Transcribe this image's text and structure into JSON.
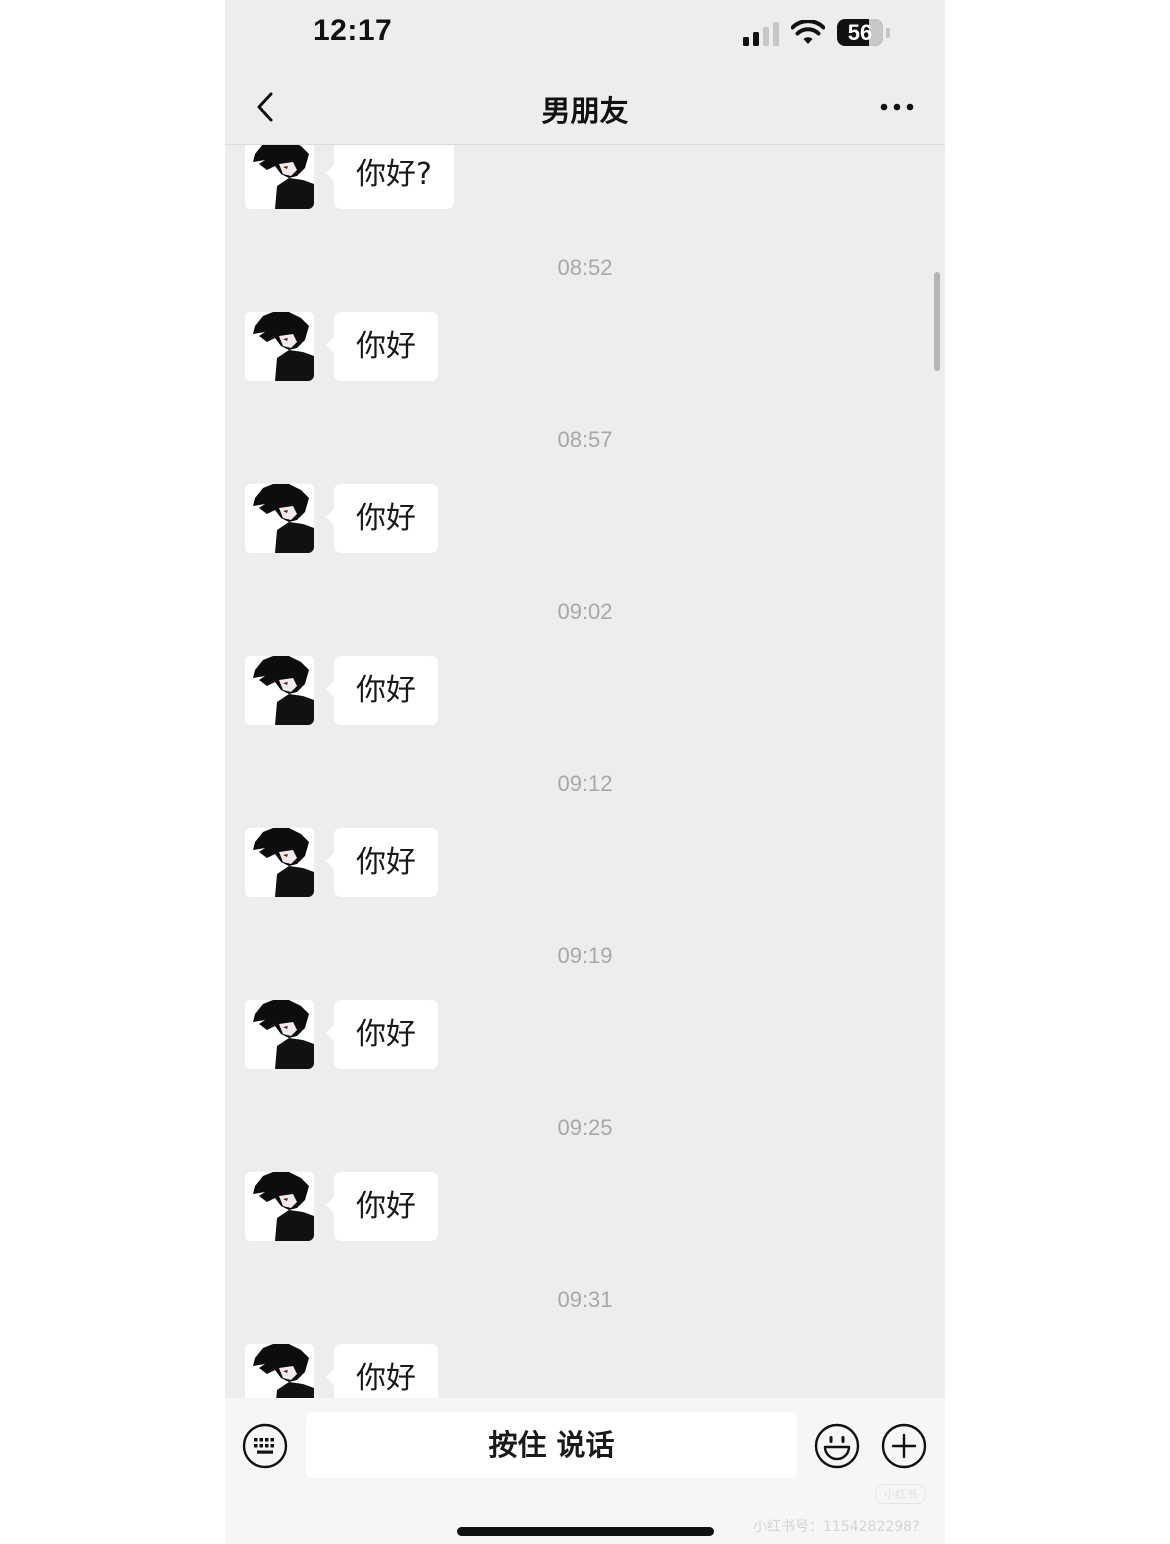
{
  "status_bar": {
    "time": "12:17",
    "battery": "56"
  },
  "nav": {
    "title": "男朋友"
  },
  "messages": [
    {
      "text": "你好?"
    },
    {
      "time": "08:52",
      "text": "你好"
    },
    {
      "time": "08:57",
      "text": "你好"
    },
    {
      "time": "09:02",
      "text": "你好"
    },
    {
      "time": "09:12",
      "text": "你好"
    },
    {
      "time": "09:19",
      "text": "你好"
    },
    {
      "time": "09:25",
      "text": "你好"
    },
    {
      "time": "09:31",
      "text": "你好"
    }
  ],
  "input": {
    "hold_to_talk": "按住 说话"
  },
  "watermark": {
    "text": "小红书号：1154282298?",
    "logo": "小红书"
  },
  "icons": {
    "back": "chevron-left-icon",
    "more": "more-dots-icon",
    "keyboard": "keyboard-icon",
    "emoji": "emoji-icon",
    "plus": "plus-icon"
  },
  "colors": {
    "chat_bg": "#ededed",
    "bubble_bg": "#ffffff",
    "timestamp": "#a8a8a8"
  }
}
